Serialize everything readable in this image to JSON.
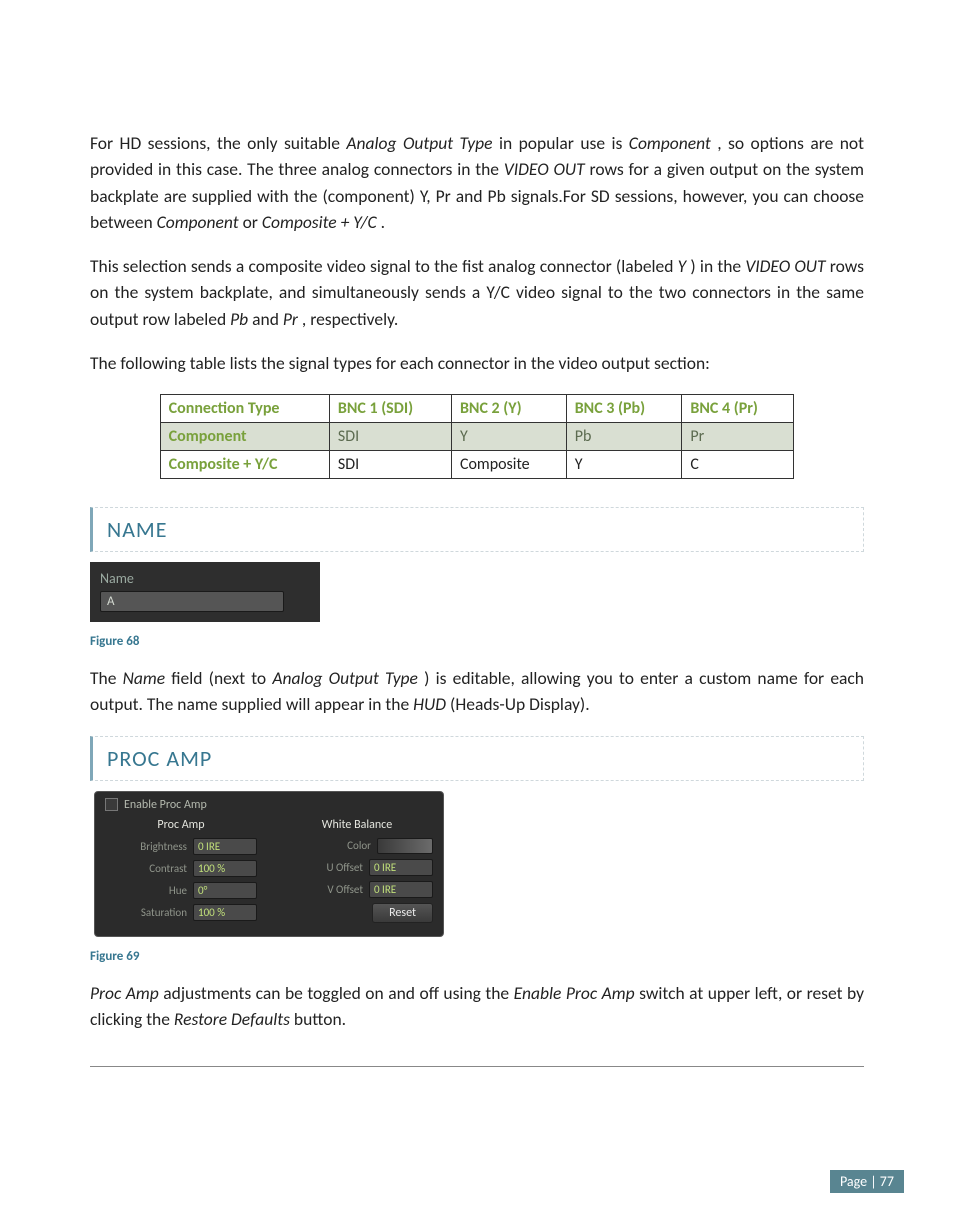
{
  "paragraphs": {
    "p1_a": "For HD sessions, the only suitable ",
    "p1_i1": "Analog Output Type",
    "p1_b": " in popular use is ",
    "p1_i2": "Component",
    "p1_c": ", so options are not provided in this case.  The three analog connectors in the ",
    "p1_i3": "VIDEO OUT",
    "p1_d": " rows for a given output on the system backplate are supplied with the (component) Y, Pr and Pb signals.For SD sessions, however, you can choose between ",
    "p1_i4": "Component",
    "p1_e": " or ",
    "p1_i5": "Composite + Y/C",
    "p1_f": ".",
    "p2_a": "This selection sends a composite video signal to the fist analog connector (labeled ",
    "p2_i1": "Y",
    "p2_b": ") in the ",
    "p2_i2": "VIDEO OUT",
    "p2_c": " rows on the system backplate, and simultaneously sends a Y/C video signal to the two connectors in the same output row labeled ",
    "p2_i3": "Pb",
    "p2_d": " and ",
    "p2_i4": "Pr",
    "p2_e": ", respectively.",
    "p3": "The following table lists the signal types for each connector in the video output section:",
    "p4_a": "The ",
    "p4_i1": "Name",
    "p4_b": " field (next to ",
    "p4_i2": "Analog Output Type",
    "p4_c": ") is editable, allowing you to enter a custom name for each output.  The name supplied will appear in the ",
    "p4_i3": "HUD",
    "p4_d": " (Heads-Up Display).",
    "p5_i1": "Proc Amp",
    "p5_a": " adjustments can be toggled on and off using the ",
    "p5_i2": "Enable Proc Amp",
    "p5_b": " switch at upper left, or reset by clicking the ",
    "p5_i3": "Restore Defaults",
    "p5_c": " button."
  },
  "table": {
    "headers": [
      "Connection Type",
      "BNC 1 (SDI)",
      "BNC 2 (Y)",
      "BNC 3 (Pb)",
      "BNC 4 (Pr)"
    ],
    "row1": [
      "Component",
      "SDI",
      "Y",
      "Pb",
      "Pr"
    ],
    "row2": [
      "Composite + Y/C",
      "SDI",
      "Composite",
      "Y",
      "C"
    ]
  },
  "section_name": "NAME",
  "name_widget": {
    "label": "Name",
    "value": "A"
  },
  "fig68": "Figure 68",
  "section_procamp": "PROC AMP",
  "procamp": {
    "enable_label": "Enable Proc Amp",
    "left_head": "Proc Amp",
    "right_head": "White Balance",
    "brightness_label": "Brightness",
    "brightness_val": "0  IRE",
    "contrast_label": "Contrast",
    "contrast_val": "100 %",
    "hue_label": "Hue",
    "hue_val": "0°",
    "saturation_label": "Saturation",
    "saturation_val": "100 %",
    "color_label": "Color",
    "uoffset_label": "U Offset",
    "uoffset_val": "0  IRE",
    "voffset_label": "V Offset",
    "voffset_val": "0  IRE",
    "reset": "Reset"
  },
  "fig69": "Figure 69",
  "page_number": "Page | 77"
}
